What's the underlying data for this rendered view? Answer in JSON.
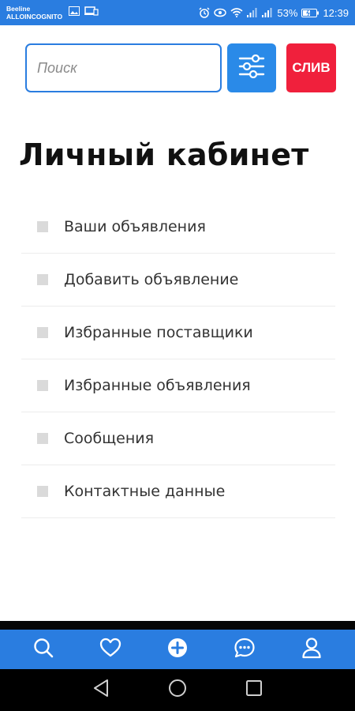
{
  "status_bar": {
    "carrier_line1": "Beeline",
    "carrier_line2": "ALLOINCOGNITO",
    "battery_percent": "53%",
    "time": "12:39"
  },
  "search": {
    "placeholder": "Поиск",
    "value": ""
  },
  "header": {
    "filter_icon": "sliders-icon",
    "sliv_label": "СЛИВ"
  },
  "page": {
    "title": "Личный кабинет"
  },
  "menu": {
    "items": [
      {
        "label": "Ваши объявления"
      },
      {
        "label": "Добавить объявление"
      },
      {
        "label": "Избранные поставщики"
      },
      {
        "label": "Избранные объявления"
      },
      {
        "label": "Сообщения"
      },
      {
        "label": "Контактные данные"
      }
    ]
  },
  "bottom_nav": {
    "icons": [
      "search-icon",
      "heart-icon",
      "add-circle-icon",
      "chat-icon",
      "user-icon"
    ]
  },
  "system_nav": {
    "icons": [
      "back-icon",
      "home-icon",
      "recents-icon"
    ]
  },
  "colors": {
    "primary": "#2a7de0",
    "accent_red": "#f0203c",
    "bullet": "#dadada"
  }
}
